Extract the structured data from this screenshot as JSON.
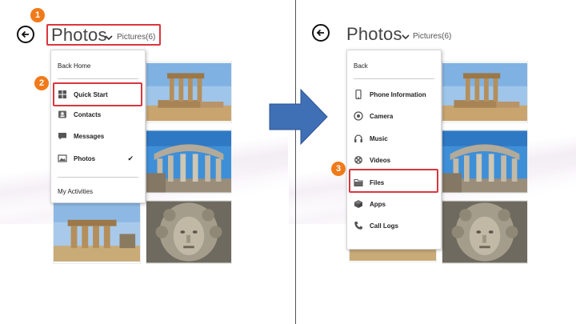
{
  "left_panel": {
    "title": "Photos",
    "subtitle": "Pictures(6)",
    "menu": {
      "back_label": "Back Home",
      "items": [
        {
          "label": "Quick Start",
          "icon": "grid-icon"
        },
        {
          "label": "Contacts",
          "icon": "contacts-icon"
        },
        {
          "label": "Messages",
          "icon": "message-icon"
        },
        {
          "label": "Photos",
          "icon": "photo-icon",
          "checked_mark": "✔"
        }
      ],
      "footer_label": "My Activities"
    }
  },
  "right_panel": {
    "title": "Photos",
    "subtitle": "Pictures(6)",
    "menu": {
      "back_label": "Back",
      "items": [
        {
          "label": "Phone Information",
          "icon": "phone-icon"
        },
        {
          "label": "Camera",
          "icon": "camera-icon"
        },
        {
          "label": "Music",
          "icon": "headphones-icon"
        },
        {
          "label": "Videos",
          "icon": "film-reel-icon"
        },
        {
          "label": "Files",
          "icon": "folder-icon"
        },
        {
          "label": "Apps",
          "icon": "apps-icon"
        },
        {
          "label": "Call Logs",
          "icon": "call-log-icon"
        }
      ]
    }
  },
  "badges": [
    "1",
    "2",
    "3"
  ],
  "colors": {
    "badge": "#f07a1a",
    "highlight": "#d9363e",
    "arrow": "#3f6fb5"
  }
}
